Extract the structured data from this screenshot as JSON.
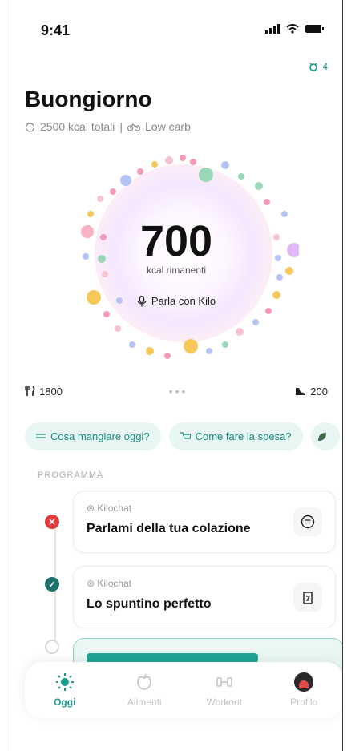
{
  "status": {
    "time": "9:41"
  },
  "header": {
    "badge_count": "4"
  },
  "greeting": {
    "title": "Buongiorno",
    "kcal_total": "2500 kcal totali",
    "separator": "|",
    "diet": "Low carb"
  },
  "ring": {
    "value": "700",
    "label": "kcal rimanenti",
    "talk_label": "Parla con Kilo"
  },
  "stats": {
    "eaten": "1800",
    "burned": "200",
    "dots": "•••"
  },
  "chips": [
    {
      "label": "Cosa mangiare oggi?"
    },
    {
      "label": "Come fare la spesa?"
    }
  ],
  "program": {
    "section_label": "PROGRAMMA",
    "items": [
      {
        "tag": "Kilochat",
        "title": "Parlami della tua colazione",
        "status": "error"
      },
      {
        "tag": "Kilochat",
        "title": "Lo spuntino perfetto",
        "status": "done"
      }
    ]
  },
  "tabs": [
    {
      "label": "Oggi",
      "icon": "sun-icon"
    },
    {
      "label": "Alimenti",
      "icon": "apple-icon"
    },
    {
      "label": "Workout",
      "icon": "dumbbell-icon"
    },
    {
      "label": "Profilo",
      "icon": "avatar"
    }
  ],
  "colors": {
    "accent": "#1a9c8f",
    "error": "#e23b3b",
    "done": "#1f6f6b"
  }
}
